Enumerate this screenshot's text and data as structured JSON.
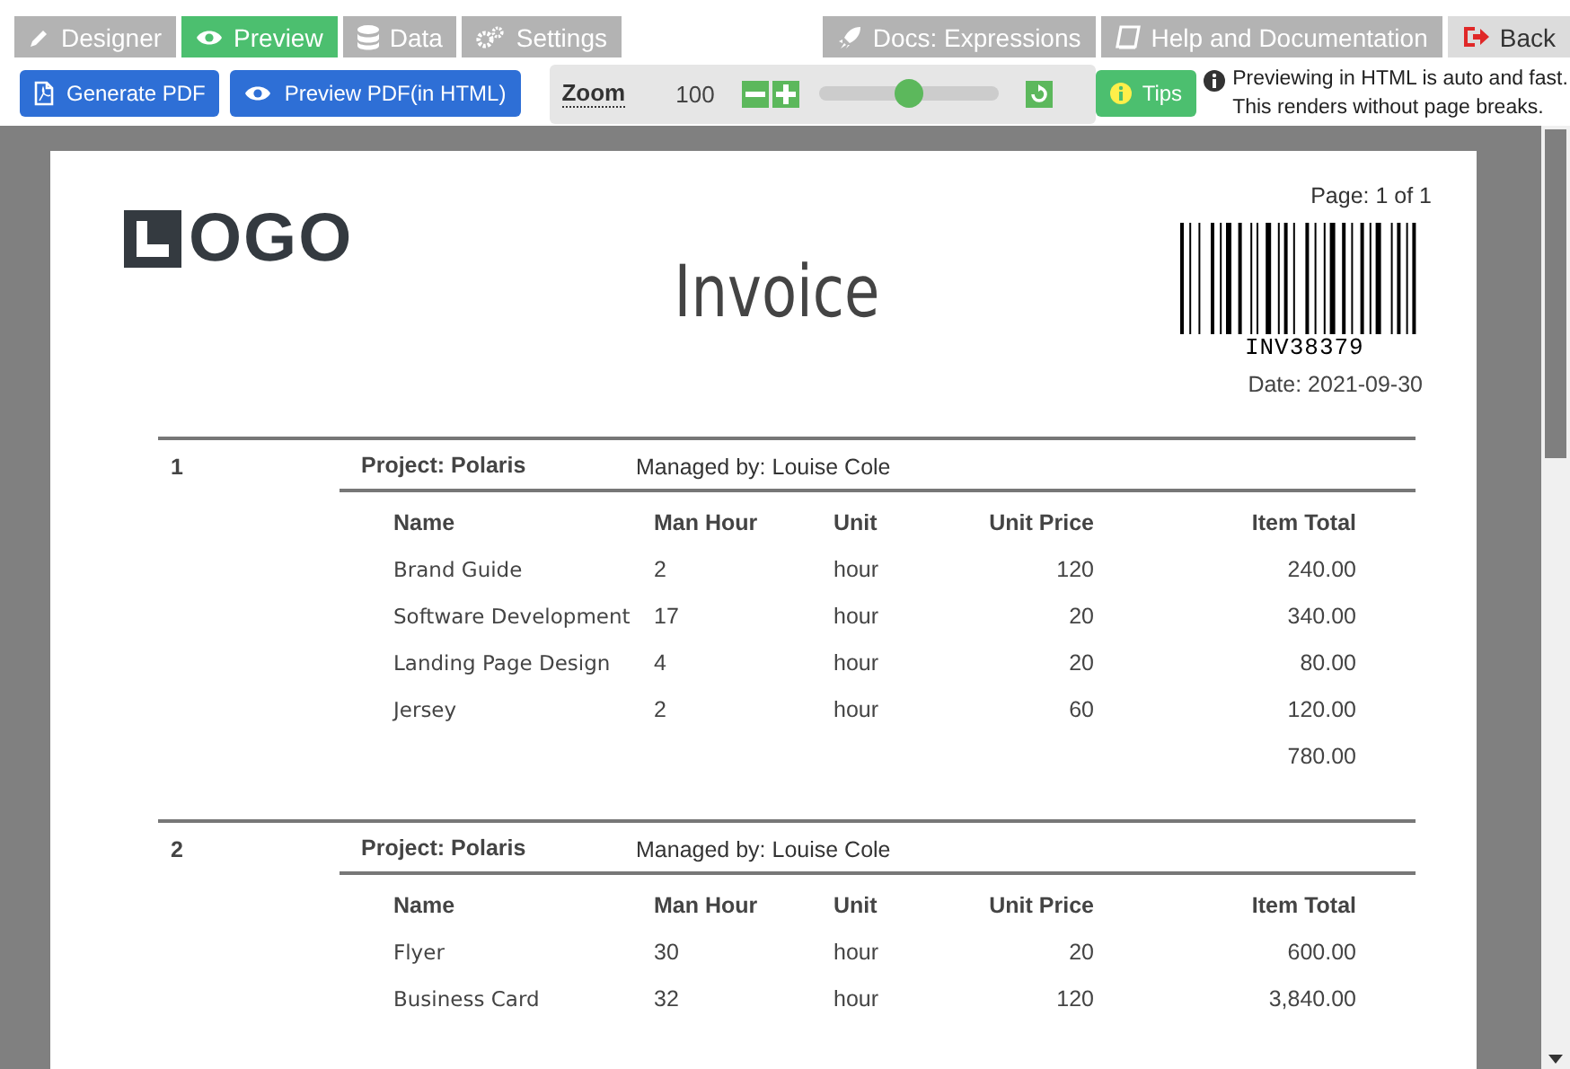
{
  "tabs_left": [
    {
      "label": "Designer",
      "selected": false
    },
    {
      "label": "Preview",
      "selected": true
    },
    {
      "label": "Data",
      "selected": false
    },
    {
      "label": "Settings",
      "selected": false
    }
  ],
  "tabs_right": [
    {
      "label": "Docs: Expressions",
      "selected": false
    },
    {
      "label": "Help and Documentation",
      "selected": false
    },
    {
      "label": "Back",
      "selected": false
    }
  ],
  "toolbar": {
    "buttons": [
      "Generate PDF",
      "Preview PDF(in HTML)"
    ],
    "zoom": {
      "label": "Zoom",
      "value": "100",
      "level": 0.5
    },
    "tips": "Tips",
    "info": "Previewing in HTML is auto and fast. This renders without page breaks."
  },
  "invoice": {
    "logo": "OGO",
    "title": "Invoice",
    "page": "Page: 1 of 1",
    "barcode": "INV38379",
    "date": "Date: 2021-09-30",
    "sections": [
      {
        "number": "1",
        "project": "Project: Polaris",
        "manager": "Managed by: Louise Cole",
        "columns": [
          "Name",
          "Man Hour",
          "Unit",
          "Unit Price",
          "Item Total"
        ],
        "rows": [
          [
            "Brand Guide",
            "2",
            "hour",
            "120",
            "240.00"
          ],
          [
            "Software Development",
            "17",
            "hour",
            "20",
            "340.00"
          ],
          [
            "Landing Page Design",
            "4",
            "hour",
            "20",
            "80.00"
          ],
          [
            "Jersey",
            "2",
            "hour",
            "60",
            "120.00"
          ]
        ],
        "total": "780.00"
      },
      {
        "number": "2",
        "project": "Project: Polaris",
        "manager": "Managed by: Louise Cole",
        "columns": [
          "Name",
          "Man Hour",
          "Unit",
          "Unit Price",
          "Item Total"
        ],
        "rows": [
          [
            "Flyer",
            "30",
            "hour",
            "20",
            "600.00"
          ],
          [
            "Business Card",
            "32",
            "hour",
            "120",
            "3,840.00"
          ]
        ]
      }
    ]
  }
}
